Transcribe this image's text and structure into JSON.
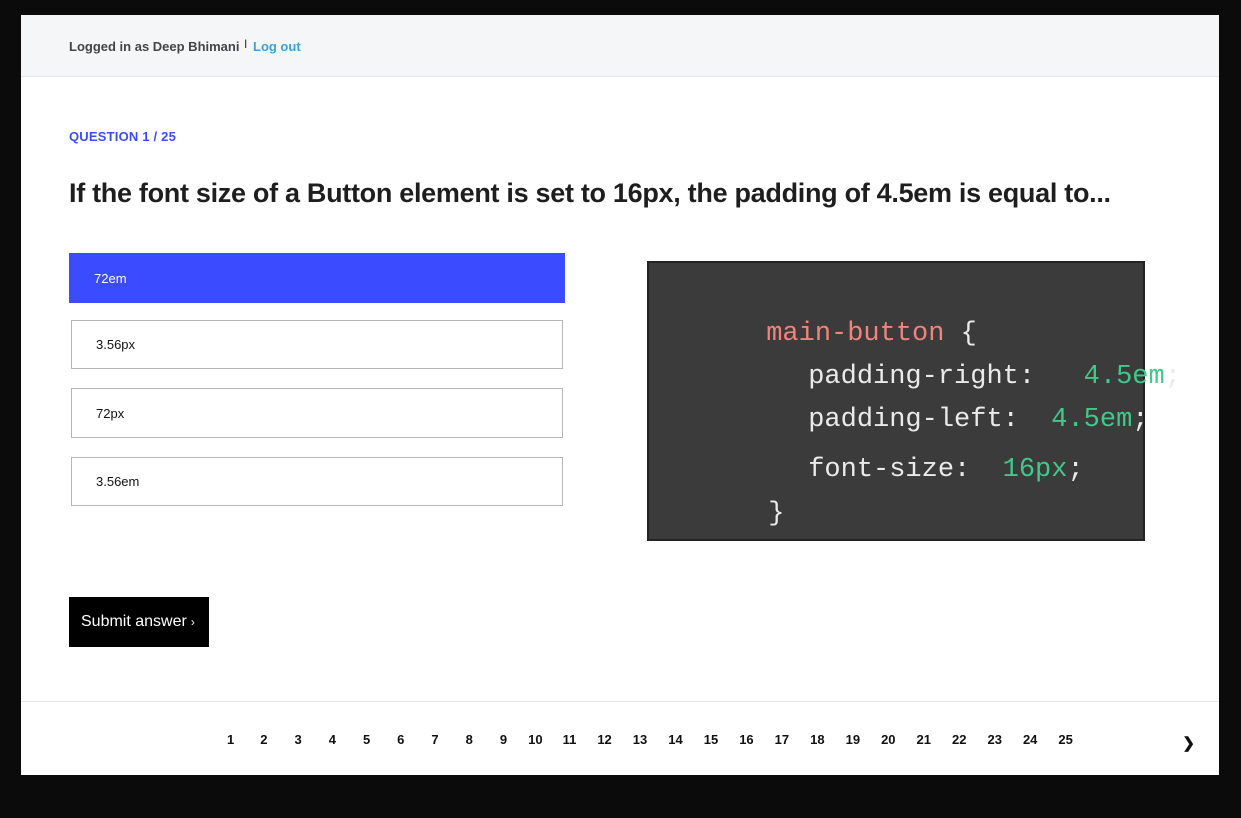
{
  "header": {
    "login_text": "Logged in as Deep Bhimani",
    "separator": "I",
    "logout_label": "Log out"
  },
  "question": {
    "counter": "QUESTION 1 / 25",
    "title": "If the font size of a Button element is set to 16px, the padding of 4.5em is equal to..."
  },
  "options": [
    {
      "label": "72em",
      "selected": true
    },
    {
      "label": "3.56px",
      "selected": false
    },
    {
      "label": "72px",
      "selected": false
    },
    {
      "label": "3.56em",
      "selected": false
    }
  ],
  "code": {
    "selector": "main-button",
    "open_brace": "{",
    "close_brace": "}",
    "lines": [
      {
        "prop": "padding-right:",
        "value": "4.5em",
        "end": ";"
      },
      {
        "prop": "padding-left:",
        "value": "4.5em",
        "end": ";"
      },
      {
        "prop": "font-size:",
        "value": "16px",
        "end": ";"
      }
    ]
  },
  "submit": {
    "label": "Submit answer",
    "arrow": "›"
  },
  "pagination": {
    "pages": [
      "1",
      "2",
      "3",
      "4",
      "5",
      "6",
      "7",
      "8",
      "9",
      "10",
      "11",
      "12",
      "13",
      "14",
      "15",
      "16",
      "17",
      "18",
      "19",
      "20",
      "21",
      "22",
      "23",
      "24",
      "25"
    ],
    "next_icon": "❯"
  },
  "colors": {
    "accent": "#3b4bff",
    "link": "#3aa0e0",
    "code_bg": "#3b3b3b",
    "code_selector": "#f2837a",
    "code_value": "#3fc98a"
  }
}
